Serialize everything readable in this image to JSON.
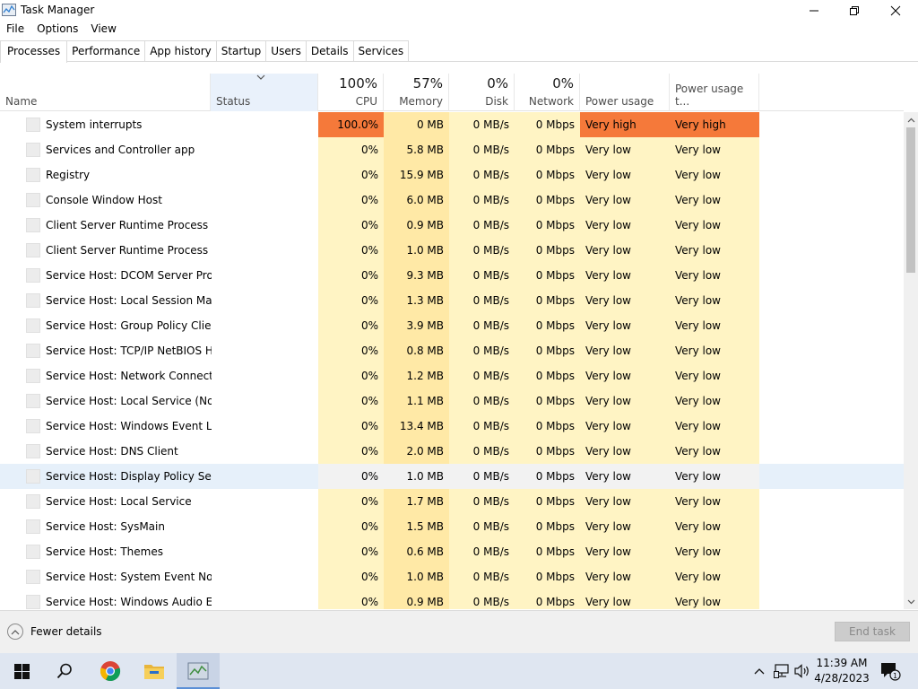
{
  "window": {
    "title": "Task Manager"
  },
  "menu": [
    "File",
    "Options",
    "View"
  ],
  "tabs": [
    "Processes",
    "Performance",
    "App history",
    "Startup",
    "Users",
    "Details",
    "Services"
  ],
  "columns": {
    "name": "Name",
    "status": "Status",
    "cpu": {
      "pct": "100%",
      "label": "CPU"
    },
    "memory": {
      "pct": "57%",
      "label": "Memory"
    },
    "disk": {
      "pct": "0%",
      "label": "Disk"
    },
    "network": {
      "pct": "0%",
      "label": "Network"
    },
    "power": "Power usage",
    "power_trend": "Power usage t..."
  },
  "processes": [
    {
      "name": "System interrupts",
      "cpu": "100.0%",
      "mem": "0 MB",
      "disk": "0 MB/s",
      "net": "0 Mbps",
      "power": "Very high",
      "trend": "Very high"
    },
    {
      "name": "Services and Controller app",
      "cpu": "0%",
      "mem": "5.8 MB",
      "disk": "0 MB/s",
      "net": "0 Mbps",
      "power": "Very low",
      "trend": "Very low"
    },
    {
      "name": "Registry",
      "cpu": "0%",
      "mem": "15.9 MB",
      "disk": "0 MB/s",
      "net": "0 Mbps",
      "power": "Very low",
      "trend": "Very low"
    },
    {
      "name": "Console Window Host",
      "cpu": "0%",
      "mem": "6.0 MB",
      "disk": "0 MB/s",
      "net": "0 Mbps",
      "power": "Very low",
      "trend": "Very low"
    },
    {
      "name": "Client Server Runtime Process",
      "cpu": "0%",
      "mem": "0.9 MB",
      "disk": "0 MB/s",
      "net": "0 Mbps",
      "power": "Very low",
      "trend": "Very low"
    },
    {
      "name": "Client Server Runtime Process",
      "cpu": "0%",
      "mem": "1.0 MB",
      "disk": "0 MB/s",
      "net": "0 Mbps",
      "power": "Very low",
      "trend": "Very low"
    },
    {
      "name": "Service Host: DCOM Server Proc...",
      "cpu": "0%",
      "mem": "9.3 MB",
      "disk": "0 MB/s",
      "net": "0 Mbps",
      "power": "Very low",
      "trend": "Very low"
    },
    {
      "name": "Service Host: Local Session Man...",
      "cpu": "0%",
      "mem": "1.3 MB",
      "disk": "0 MB/s",
      "net": "0 Mbps",
      "power": "Very low",
      "trend": "Very low"
    },
    {
      "name": "Service Host: Group Policy Client",
      "cpu": "0%",
      "mem": "3.9 MB",
      "disk": "0 MB/s",
      "net": "0 Mbps",
      "power": "Very low",
      "trend": "Very low"
    },
    {
      "name": "Service Host: TCP/IP NetBIOS H...",
      "cpu": "0%",
      "mem": "0.8 MB",
      "disk": "0 MB/s",
      "net": "0 Mbps",
      "power": "Very low",
      "trend": "Very low"
    },
    {
      "name": "Service Host: Network Connecti...",
      "cpu": "0%",
      "mem": "1.2 MB",
      "disk": "0 MB/s",
      "net": "0 Mbps",
      "power": "Very low",
      "trend": "Very low"
    },
    {
      "name": "Service Host: Local Service (No ...",
      "cpu": "0%",
      "mem": "1.1 MB",
      "disk": "0 MB/s",
      "net": "0 Mbps",
      "power": "Very low",
      "trend": "Very low"
    },
    {
      "name": "Service Host: Windows Event Log",
      "cpu": "0%",
      "mem": "13.4 MB",
      "disk": "0 MB/s",
      "net": "0 Mbps",
      "power": "Very low",
      "trend": "Very low"
    },
    {
      "name": "Service Host: DNS Client",
      "cpu": "0%",
      "mem": "2.0 MB",
      "disk": "0 MB/s",
      "net": "0 Mbps",
      "power": "Very low",
      "trend": "Very low"
    },
    {
      "name": "Service Host: Display Policy Serv...",
      "cpu": "0%",
      "mem": "1.0 MB",
      "disk": "0 MB/s",
      "net": "0 Mbps",
      "power": "Very low",
      "trend": "Very low"
    },
    {
      "name": "Service Host: Local Service",
      "cpu": "0%",
      "mem": "1.7 MB",
      "disk": "0 MB/s",
      "net": "0 Mbps",
      "power": "Very low",
      "trend": "Very low"
    },
    {
      "name": "Service Host: SysMain",
      "cpu": "0%",
      "mem": "1.5 MB",
      "disk": "0 MB/s",
      "net": "0 Mbps",
      "power": "Very low",
      "trend": "Very low"
    },
    {
      "name": "Service Host: Themes",
      "cpu": "0%",
      "mem": "0.6 MB",
      "disk": "0 MB/s",
      "net": "0 Mbps",
      "power": "Very low",
      "trend": "Very low"
    },
    {
      "name": "Service Host: System Event Noti...",
      "cpu": "0%",
      "mem": "1.0 MB",
      "disk": "0 MB/s",
      "net": "0 Mbps",
      "power": "Very low",
      "trend": "Very low"
    },
    {
      "name": "Service Host: Windows Audio E...",
      "cpu": "0%",
      "mem": "0.9 MB",
      "disk": "0 MB/s",
      "net": "0 Mbps",
      "power": "Very low",
      "trend": "Very low"
    }
  ],
  "footer": {
    "fewer_details": "Fewer details",
    "end_task": "End task"
  },
  "taskbar": {
    "icons": [
      "windows-start-icon",
      "search-icon",
      "chrome-icon",
      "file-explorer-icon",
      "task-manager-icon"
    ],
    "time": "11:39 AM",
    "date": "4/28/2023",
    "notification_count": "1"
  },
  "colors": {
    "hot": "#f5793a",
    "heat_light": "#fff4c4",
    "heat_mid": "#ffe9a6",
    "status_header": "#e9f1fb",
    "taskbar": "#dfe6f1"
  }
}
